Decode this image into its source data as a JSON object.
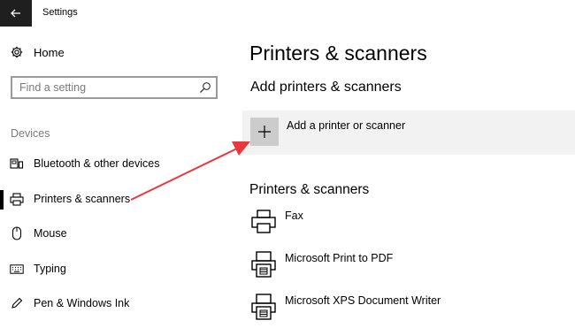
{
  "window": {
    "title": "Settings"
  },
  "sidebar": {
    "home_label": "Home",
    "search_placeholder": "Find a setting",
    "section_label": "Devices",
    "items": [
      {
        "label": "Bluetooth & other devices",
        "icon": "bluetooth-devices-icon"
      },
      {
        "label": "Printers & scanners",
        "icon": "printer-icon",
        "selected": true
      },
      {
        "label": "Mouse",
        "icon": "mouse-icon"
      },
      {
        "label": "Typing",
        "icon": "keyboard-icon"
      },
      {
        "label": "Pen & Windows Ink",
        "icon": "pen-icon"
      }
    ]
  },
  "main": {
    "title": "Printers & scanners",
    "add_section_heading": "Add printers & scanners",
    "add_button_label": "Add a printer or scanner",
    "list_heading": "Printers & scanners",
    "printers": [
      {
        "name": "Fax",
        "icon": "fax-printer-icon"
      },
      {
        "name": "Microsoft Print to PDF",
        "icon": "pdf-printer-icon"
      },
      {
        "name": "Microsoft XPS Document Writer",
        "icon": "xps-printer-icon"
      }
    ]
  },
  "annotation": {
    "arrow_color": "#e8383d"
  }
}
